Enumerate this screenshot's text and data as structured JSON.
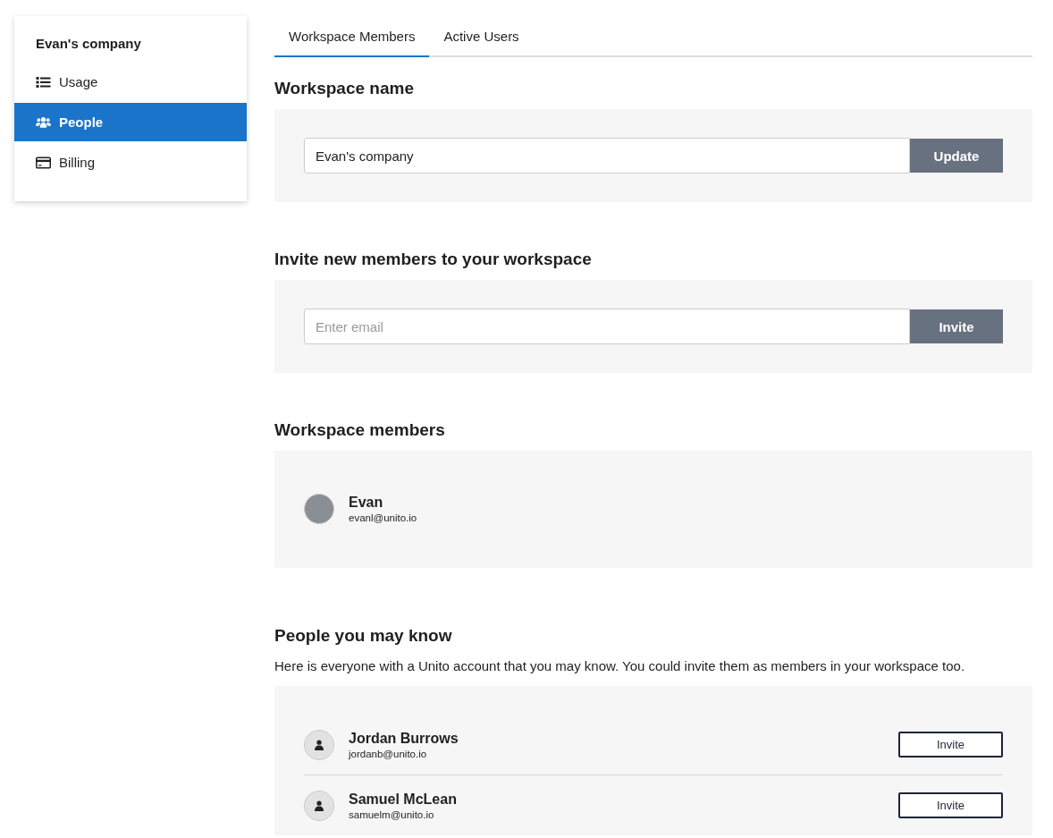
{
  "sidebar": {
    "title": "Evan's company",
    "items": [
      {
        "label": "Usage",
        "kind": "list",
        "selected": false
      },
      {
        "label": "People",
        "kind": "users",
        "selected": true
      },
      {
        "label": "Billing",
        "kind": "card",
        "selected": false
      }
    ]
  },
  "tabs": [
    {
      "label": "Workspace Members",
      "selected": true
    },
    {
      "label": "Active Users",
      "selected": false
    }
  ],
  "workspace_name": {
    "heading": "Workspace name",
    "value": "Evan's company",
    "button": "Update"
  },
  "invite": {
    "heading": "Invite new members to your workspace",
    "placeholder": "Enter email",
    "button": "Invite"
  },
  "members": {
    "heading": "Workspace members",
    "people": [
      {
        "name": "Evan",
        "email": "evanl@unito.io",
        "kind": "photo"
      }
    ]
  },
  "suggestions": {
    "heading": "People you may know",
    "description": "Here is everyone with a Unito account that you may know. You could invite them as members in your workspace too.",
    "people": [
      {
        "name": "Jordan Burrows",
        "email": "jordanb@unito.io",
        "kind": "generic",
        "button": "Invite"
      },
      {
        "name": "Samuel McLean",
        "email": "samuelm@unito.io",
        "kind": "generic",
        "button": "Invite"
      }
    ]
  }
}
